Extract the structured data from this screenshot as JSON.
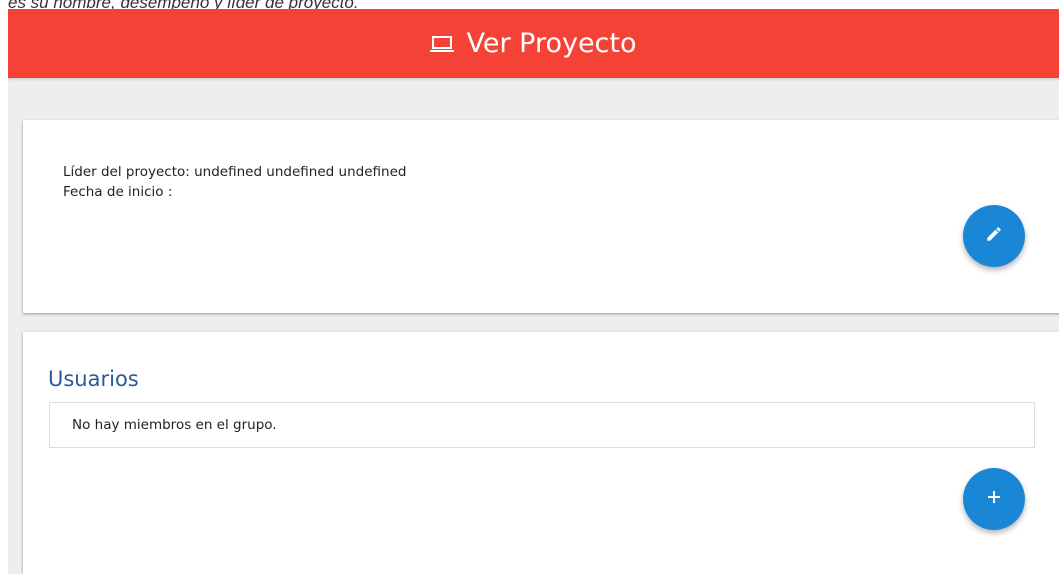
{
  "caption": "es su nombre, desempeño y líder de proyecto.",
  "header": {
    "title": "Ver Proyecto",
    "icon": "laptop-icon",
    "color": "#f44336"
  },
  "info_card": {
    "leader_label": "Líder del proyecto: undefined undefined undefined",
    "start_date_label": "Fecha de inicio :",
    "edit_icon": "pencil-icon"
  },
  "users_card": {
    "title": "Usuarios",
    "empty_message": "No hay miembros en el grupo.",
    "add_icon": "plus-icon"
  },
  "colors": {
    "fab": "#1a87d6",
    "title_blue": "#2a5a9c"
  }
}
